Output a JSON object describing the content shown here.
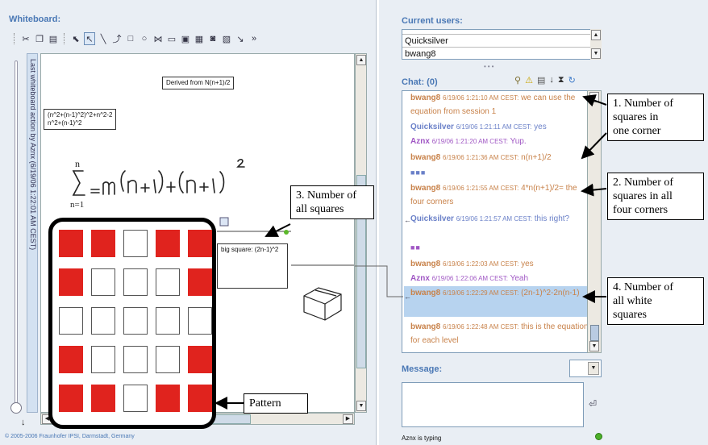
{
  "whiteboard": {
    "title": "Whiteboard:",
    "hint": "Last whiteboard action by Aznx (6/19/06 1:22:01 AM CEST)",
    "copyright": "© 2005-2006 Fraunhofer IPSI, Darmstadt, Germany",
    "tool_icons": [
      "scissors-icon",
      "copy-icon",
      "paste-icon",
      "select-icon",
      "pointer-icon",
      "line-icon",
      "connector-icon",
      "rectangle-icon",
      "ellipse-icon",
      "group-icon",
      "textbox-icon",
      "image-icon",
      "calendar-icon",
      "camera-icon",
      "properties-icon",
      "more-icon"
    ],
    "textboxes": {
      "derived": "Derived from N(n+1)/2",
      "formula_line1": "(n^2+(n-1)^2)^2+n^2-2",
      "formula_line2": "n^2+(n-1)^2",
      "big_square": "big square: (2n-1)^2"
    },
    "handwriting": {
      "sum_top": "n",
      "sum_bottom": "n=1",
      "sum_body": "=4n(n+1)+(n+1)",
      "exponent": "2"
    }
  },
  "annotations": {
    "a1": [
      "1. Number of",
      "squares in",
      "one corner"
    ],
    "a2": [
      "2. Number of",
      "squares in all",
      "four corners"
    ],
    "a3": [
      "3. Number of",
      "all squares"
    ],
    "a4": [
      "4. Number of",
      "all white",
      "squares"
    ],
    "pattern": "Pattern"
  },
  "users": {
    "title": "Current users:",
    "list": [
      "Quicksilver",
      "bwang8"
    ]
  },
  "chat": {
    "title": "Chat: (0)",
    "messages": [
      {
        "name": "bwang8",
        "meta": "6/19/06 1:21:10 AM CEST:",
        "text": "we can use the equation from session 1"
      },
      {
        "name": "Quicksilver",
        "meta": "6/19/06 1:21:11 AM CEST:",
        "text": "yes"
      },
      {
        "name": "Aznx",
        "meta": "6/19/06 1:21:20 AM CEST:",
        "text": "Yup."
      },
      {
        "name": "bwang8",
        "meta": "6/19/06 1:21:36 AM CEST:",
        "text": "n(n+1)/2"
      },
      {
        "name": "bwang8",
        "meta": "6/19/06 1:21:55 AM CEST:",
        "text": "4*n(n+1)/2= the four corners"
      },
      {
        "name": "Quicksilver",
        "meta": "6/19/06 1:21:57 AM CEST:",
        "text": "this right?"
      },
      {
        "name": "bwang8",
        "meta": "6/19/06 1:22:03 AM CEST:",
        "text": "yes"
      },
      {
        "name": "Aznx",
        "meta": "6/19/06 1:22:06 AM CEST:",
        "text": "Yeah"
      },
      {
        "name": "bwang8",
        "meta": "6/19/06 1:22:29 AM CEST:",
        "text": "(2n-1)^2-2n(n-1)"
      },
      {
        "name": "bwang8",
        "meta": "6/19/06 1:22:48 AM CEST:",
        "text": "this is the equation for each level"
      }
    ],
    "markers": [
      "■■■",
      "■■"
    ]
  },
  "message": {
    "title": "Message:",
    "typing": "Aznx is typing"
  },
  "colors": {
    "accent": "#4a78b5",
    "square_red": "#e0231e",
    "selected_row": "#b7d3ef",
    "online": "#4caf2a"
  },
  "pattern_grid": [
    [
      "red",
      "red",
      "white",
      "red",
      "red"
    ],
    [
      "red",
      "white",
      "white",
      "white",
      "red"
    ],
    [
      "white",
      "white",
      "white",
      "white",
      "white"
    ],
    [
      "red",
      "white",
      "white",
      "white",
      "red"
    ],
    [
      "red",
      "red",
      "white",
      "red",
      "red"
    ]
  ]
}
